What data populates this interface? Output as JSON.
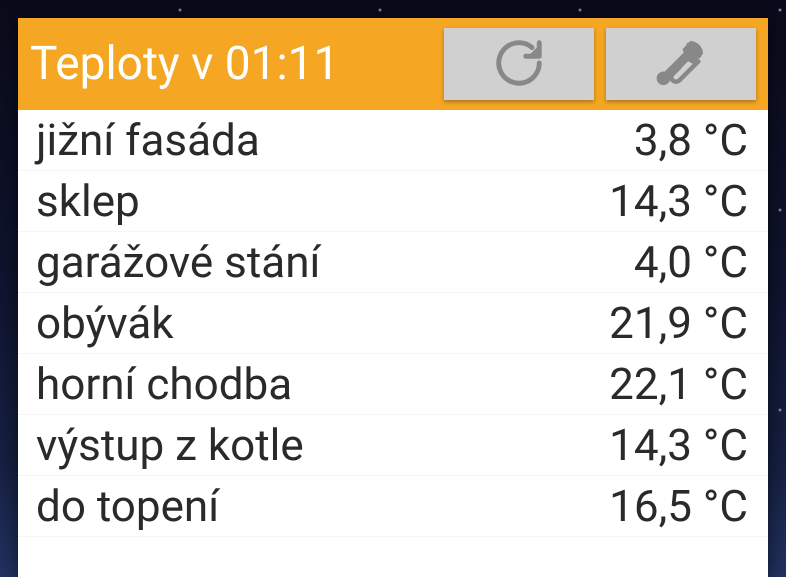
{
  "header": {
    "title": "Teploty v 01:11"
  },
  "rows": [
    {
      "label": "jižní fasáda",
      "value": "3,8 °C"
    },
    {
      "label": "sklep",
      "value": "14,3 °C"
    },
    {
      "label": "garážové stání",
      "value": "4,0 °C"
    },
    {
      "label": "obývák",
      "value": "21,9 °C"
    },
    {
      "label": "horní chodba",
      "value": "22,1 °C"
    },
    {
      "label": "výstup z kotle",
      "value": "14,3 °C"
    },
    {
      "label": "do topení",
      "value": "16,5 °C"
    }
  ]
}
